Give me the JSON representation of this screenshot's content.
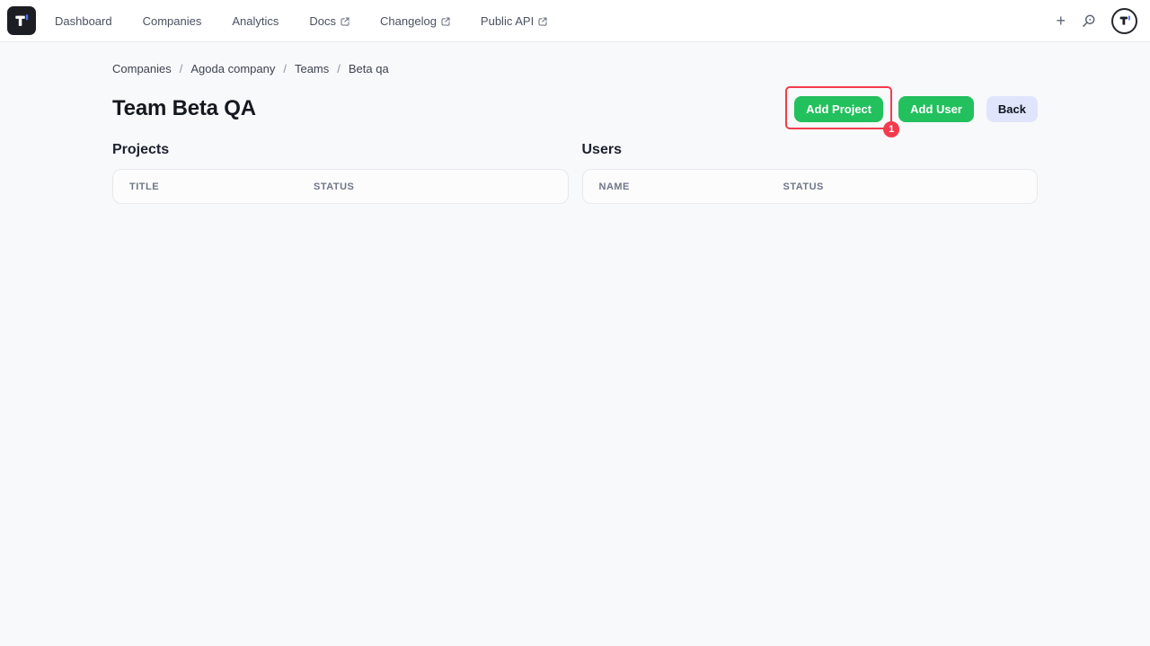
{
  "nav": {
    "items": [
      {
        "label": "Dashboard",
        "external": false
      },
      {
        "label": "Companies",
        "external": false
      },
      {
        "label": "Analytics",
        "external": false
      },
      {
        "label": "Docs",
        "external": true
      },
      {
        "label": "Changelog",
        "external": true
      },
      {
        "label": "Public API",
        "external": true
      }
    ],
    "right": {
      "plus": "+",
      "icons": [
        "plus-icon",
        "search-icon",
        "avatar-logo"
      ]
    }
  },
  "breadcrumb": {
    "separator": "/",
    "items": [
      "Companies",
      "Agoda company",
      "Teams",
      "Beta qa"
    ]
  },
  "page": {
    "title": "Team Beta QA"
  },
  "actions": {
    "add_project": "Add Project",
    "add_user": "Add User",
    "back": "Back",
    "annotation_badge": "1"
  },
  "projects": {
    "heading": "Projects",
    "columns": [
      "TITLE",
      "STATUS"
    ],
    "rows": []
  },
  "users": {
    "heading": "Users",
    "columns": [
      "NAME",
      "STATUS"
    ],
    "rows": []
  },
  "colors": {
    "accent_green": "#23c05e",
    "back_button_bg": "#e0e5fb",
    "annotation_red": "#f43b4e",
    "logo_blue": "#4a6cf7",
    "page_bg": "#f8f9fa"
  }
}
